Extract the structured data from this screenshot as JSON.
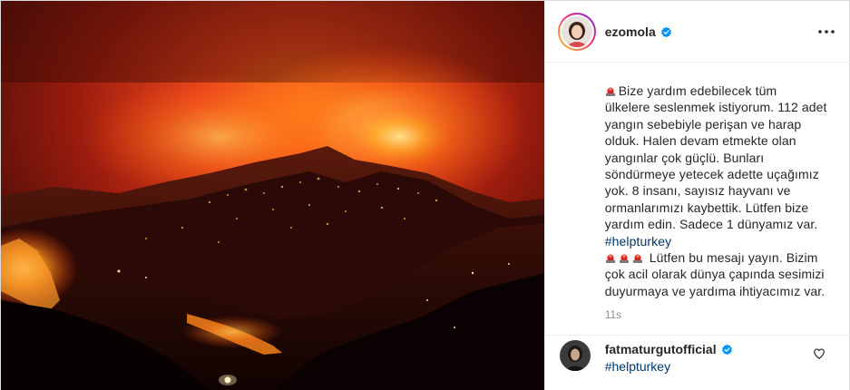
{
  "post": {
    "author": "ezomola",
    "caption_cut": "",
    "caption_lines": [
      "Bize yardım edebilecek tüm",
      "ülkelere seslenmek istiyorum. 112 adet",
      "yangın sebebiyle perişan ve harap",
      "olduk. Halen devam etmekte olan",
      "yangınlar çok güçlü. Bunları",
      "söndürmeye yetecek adette uçağımız",
      "yok. 8 insanı, sayısız hayvanı ve",
      "ormanlarımızı kaybettik. Lütfen bize",
      "yardım edin. Sadece 1 dünyamız var."
    ],
    "hashtag": "#helpturkey",
    "caption_lines_2": [
      "Lütfen bu mesajı yayın. Bizim",
      "çok acil olarak dünya çapında sesimizi",
      "duyurmaya ve yardıma ihtiyacımız var."
    ],
    "time": "11s"
  },
  "comment": {
    "user": "fatmaturgutofficial",
    "text": "#helpturkey"
  },
  "icons": {
    "verified": "verified-badge-icon",
    "more": "more-options-icon",
    "like": "heart-icon",
    "siren": "police-light-emoji"
  },
  "colors": {
    "verified_blue": "#0095f6",
    "hashtag": "#00376b",
    "muted": "#8e8e8e",
    "siren_red": "#d7261e"
  }
}
